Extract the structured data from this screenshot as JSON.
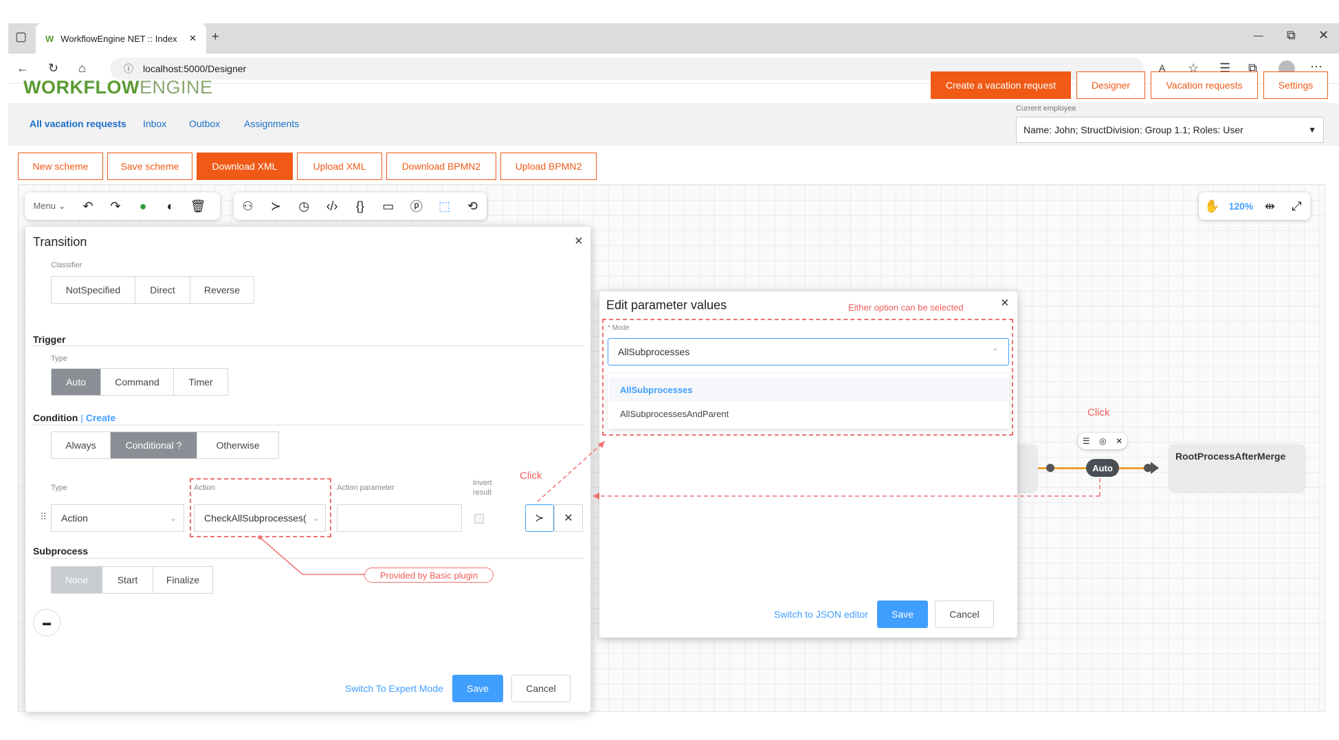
{
  "browser": {
    "tab_title": "WorkflowEngine NET :: Index",
    "url": "localhost:5000/Designer"
  },
  "header": {
    "logo_bold": "WORKFLOW",
    "logo_light": "ENGINE",
    "buttons": [
      "Create a vacation request",
      "Designer",
      "Vacation requests",
      "Settings"
    ]
  },
  "nav": {
    "items": [
      "All vacation requests",
      "Inbox",
      "Outbox",
      "Assignments"
    ],
    "current_employee_label": "Current employee",
    "current_employee_value": "Name: John; StructDivision: Group 1.1; Roles: User"
  },
  "scheme_buttons": [
    "New scheme",
    "Save scheme",
    "Download XML",
    "Upload XML",
    "Download BPMN2",
    "Upload BPMN2"
  ],
  "toolbar": {
    "menu_label": "Menu",
    "zoom": "120%"
  },
  "transition": {
    "title": "Transition",
    "classifier_label": "Classifier",
    "classifier_options": [
      "NotSpecified",
      "Direct",
      "Reverse"
    ],
    "trigger_label": "Trigger",
    "trigger_type_label": "Type",
    "trigger_options": [
      "Auto",
      "Command",
      "Timer"
    ],
    "condition_label": "Condition",
    "condition_create": "Create",
    "condition_options": [
      "Always",
      "Conditional ?",
      "Otherwise"
    ],
    "col_type": "Type",
    "col_action": "Action",
    "col_action_param": "Action parameter",
    "col_invert": "Invert result",
    "row_type": "Action",
    "row_action": "CheckAllSubprocesses(",
    "subprocess_label": "Subprocess",
    "subprocess_options": [
      "None",
      "Start",
      "Finalize"
    ],
    "expert_mode": "Switch To Expert Mode",
    "save": "Save",
    "cancel": "Cancel"
  },
  "edit_params": {
    "title": "Edit parameter values",
    "mode_label": "* Mode",
    "mode_value": "AllSubprocesses",
    "options": [
      "AllSubprocesses",
      "AllSubprocessesAndParent"
    ],
    "json_editor": "Switch to JSON editor",
    "save": "Save",
    "cancel": "Cancel"
  },
  "annotations": {
    "either_option": "Either option can be selected",
    "click1": "Click",
    "click2": "Click",
    "provided_by": "Provided by Basic plugin"
  },
  "diagram": {
    "auto_label": "Auto",
    "node_label": "RootProcessAfterMerge"
  },
  "colors": {
    "accent": "#f05a16",
    "logo_green": "#5b9b32",
    "link_blue": "#1a6fc9",
    "primary_blue": "#409eff",
    "annotation_red": "#f07070"
  }
}
